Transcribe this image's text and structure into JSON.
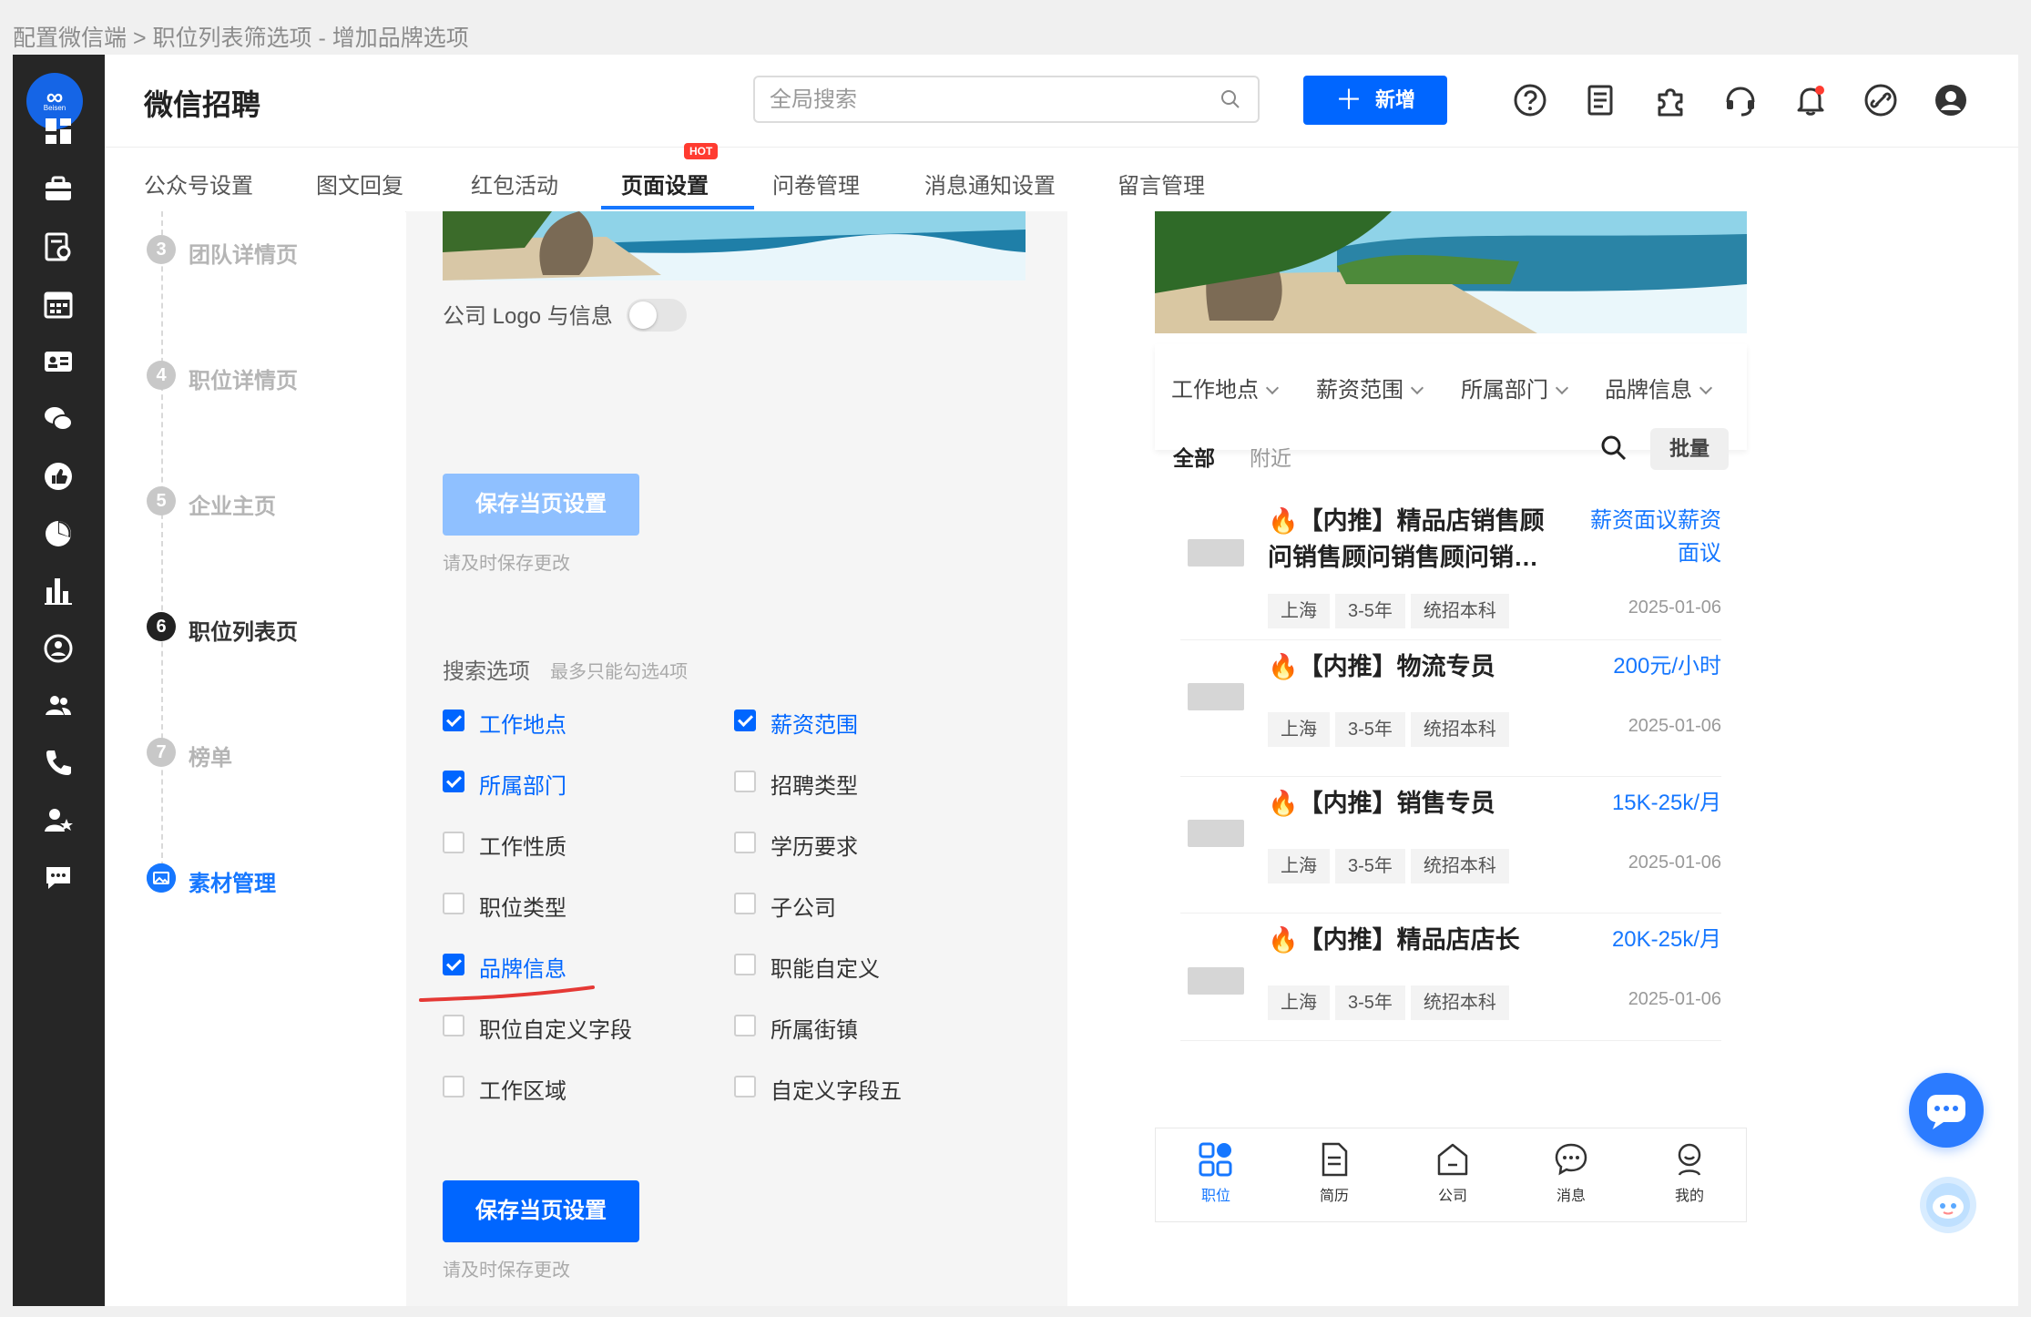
{
  "breadcrumb": "配置微信端 > 职位列表筛选项 - 增加品牌选项",
  "logo": {
    "text": "∞",
    "sub": "Beisen"
  },
  "header": {
    "title": "微信招聘",
    "search_placeholder": "全局搜索",
    "add_label": "新增",
    "add_plus": "＋"
  },
  "tabs": [
    {
      "label": "公众号设置"
    },
    {
      "label": "图文回复"
    },
    {
      "label": "红包活动"
    },
    {
      "label": "页面设置",
      "badge": "HOT"
    },
    {
      "label": "问卷管理"
    },
    {
      "label": "消息通知设置"
    },
    {
      "label": "留言管理"
    }
  ],
  "steps": [
    {
      "num": "3",
      "label": "团队详情页"
    },
    {
      "num": "4",
      "label": "职位详情页"
    },
    {
      "num": "5",
      "label": "企业主页"
    },
    {
      "num": "6",
      "label": "职位列表页"
    },
    {
      "num": "7",
      "label": "榜单"
    },
    {
      "label": "素材管理"
    }
  ],
  "settings": {
    "logo_toggle_label": "公司 Logo 与信息",
    "logo_toggle_on": false,
    "save_label": "保存当页设置",
    "save_hint": "请及时保存更改",
    "search_title": "搜索选项",
    "search_sub": "最多只能勾选4项",
    "options": [
      {
        "label": "工作地点",
        "checked": true
      },
      {
        "label": "薪资范围",
        "checked": true
      },
      {
        "label": "所属部门",
        "checked": true
      },
      {
        "label": "招聘类型",
        "checked": false
      },
      {
        "label": "工作性质",
        "checked": false
      },
      {
        "label": "学历要求",
        "checked": false
      },
      {
        "label": "职位类型",
        "checked": false
      },
      {
        "label": "子公司",
        "checked": false
      },
      {
        "label": "品牌信息",
        "checked": true
      },
      {
        "label": "职能自定义",
        "checked": false
      },
      {
        "label": "职位自定义字段",
        "checked": false
      },
      {
        "label": "所属街镇",
        "checked": false
      },
      {
        "label": "工作区域",
        "checked": false
      },
      {
        "label": "自定义字段五",
        "checked": false
      }
    ]
  },
  "preview": {
    "filters": [
      "工作地点",
      "薪资范围",
      "所属部门",
      "品牌信息"
    ],
    "scope_all": "全部",
    "scope_near": "附近",
    "batch": "批量",
    "jobs": [
      {
        "title": "【内推】精品店销售顾问销售顾问销售顾问销…",
        "salary": "薪资面议薪资面议",
        "tags": [
          "上海",
          "3-5年",
          "统招本科"
        ],
        "date": "2025-01-06"
      },
      {
        "title": "【内推】物流专员",
        "salary": "200元/小时",
        "tags": [
          "上海",
          "3-5年",
          "统招本科"
        ],
        "date": "2025-01-06"
      },
      {
        "title": "【内推】销售专员",
        "salary": "15K-25k/月",
        "tags": [
          "上海",
          "3-5年",
          "统招本科"
        ],
        "date": "2025-01-06"
      },
      {
        "title": "【内推】精品店店长",
        "salary": "20K-25k/月",
        "tags": [
          "上海",
          "3-5年",
          "统招本科"
        ],
        "date": "2025-01-06"
      }
    ],
    "nav": [
      "职位",
      "简历",
      "公司",
      "消息",
      "我的"
    ]
  },
  "colors": {
    "accent": "#0066ff",
    "sidebar": "#262626",
    "annotation_red": "#e53935",
    "hot_badge": "#ff3b30"
  }
}
